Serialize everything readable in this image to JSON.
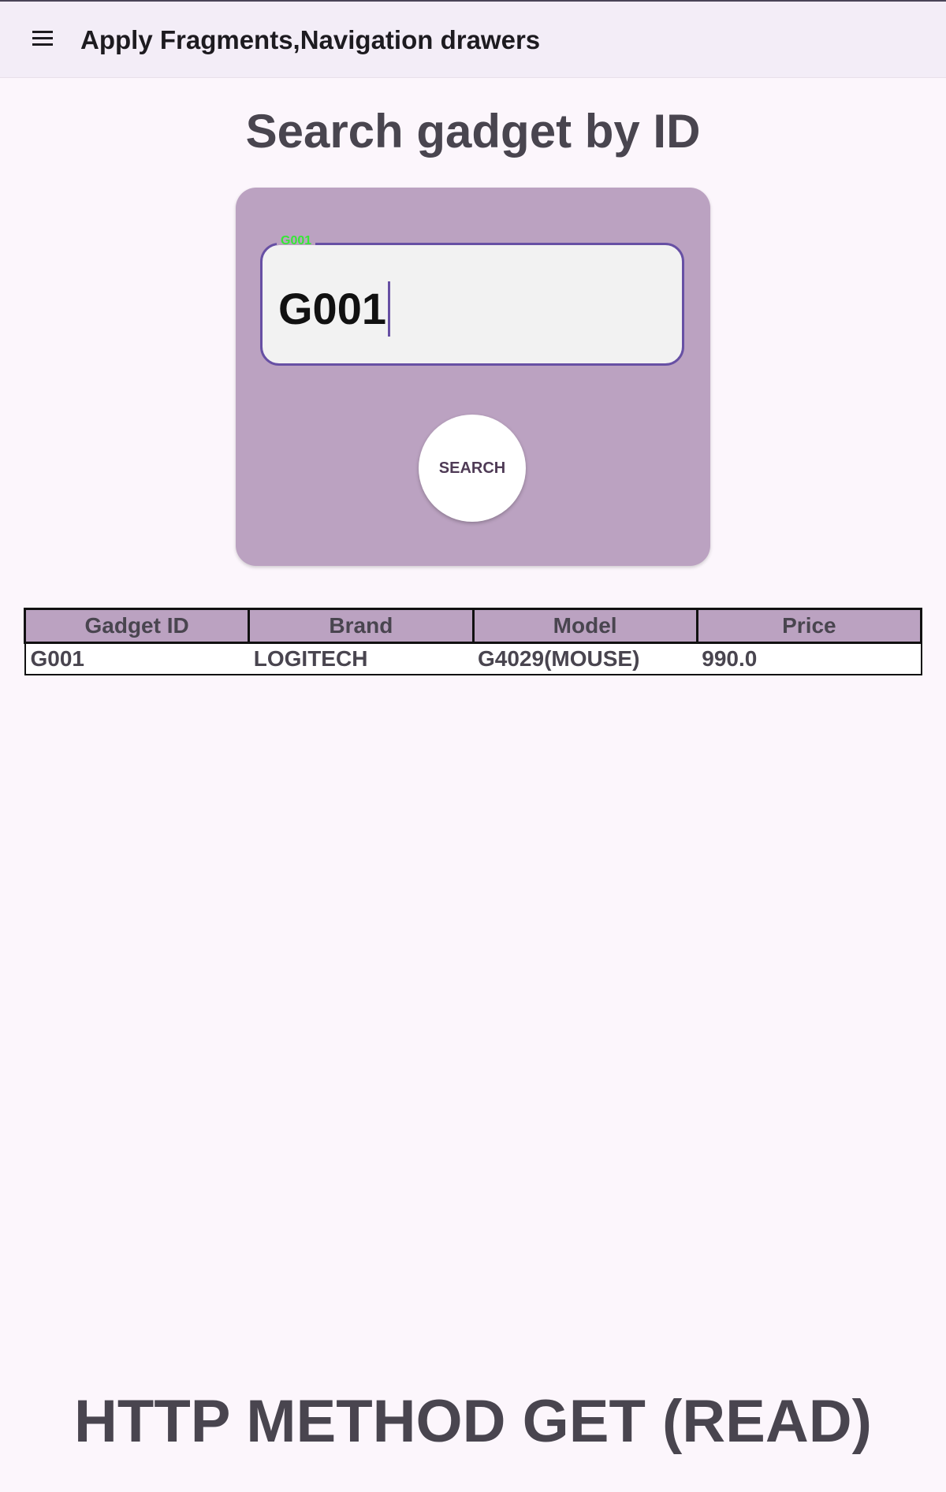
{
  "app_bar": {
    "menu_icon": "hamburger-menu-icon",
    "title": "Apply Fragments,Navigation drawers"
  },
  "heading": "Search gadget by ID",
  "search_card": {
    "field_label": "G001",
    "field_value": "G001",
    "search_button_label": "SEARCH"
  },
  "results": {
    "columns": [
      "Gadget ID",
      "Brand",
      "Model",
      "Price"
    ],
    "rows": [
      [
        "G001",
        "LOGITECH",
        "G4029(MOUSE)",
        "990.0"
      ]
    ]
  },
  "footer_caption": "HTTP METHOD GET (READ)",
  "colors": {
    "background": "#fcf6fc",
    "app_bar": "#f3edf7",
    "card": "#bba2c1",
    "field_outline": "#6750a4",
    "field_label": "#35e835",
    "text_dark": "#49454f"
  }
}
